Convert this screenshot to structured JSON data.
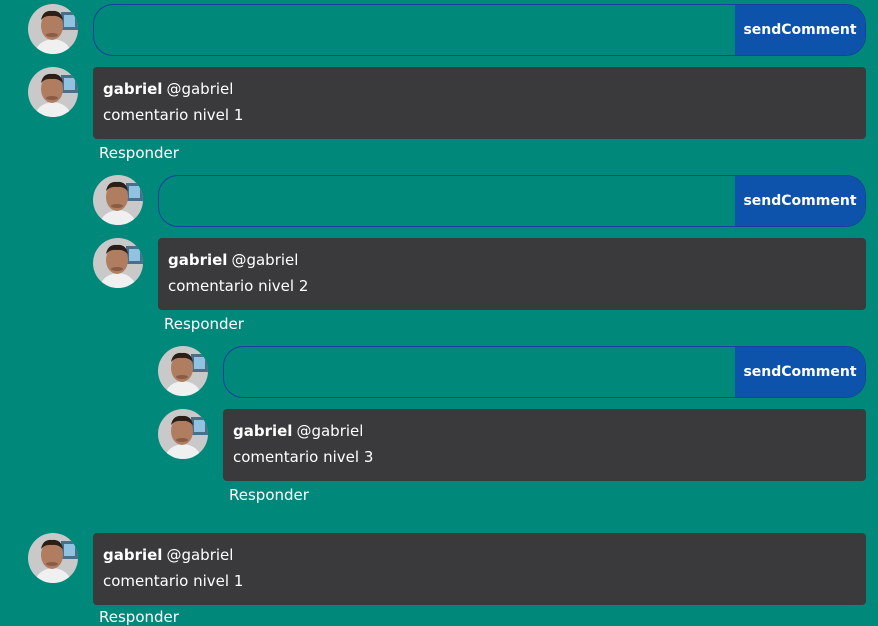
{
  "composer": {
    "input_value": "",
    "send_label": "sendComment"
  },
  "comments": [
    {
      "author": "gabriel",
      "handle": "@gabriel",
      "text": "comentario nivel 1",
      "reply_label": "Responder"
    },
    {
      "author": "gabriel",
      "handle": "@gabriel",
      "text": "comentario nivel 2",
      "reply_label": "Responder"
    },
    {
      "author": "gabriel",
      "handle": "@gabriel",
      "text": "comentario nivel 3",
      "reply_label": "Responder"
    },
    {
      "author": "gabriel",
      "handle": "@gabriel",
      "text": "comentario nivel 1",
      "reply_label": "Responder"
    }
  ],
  "colors": {
    "background": "#00897b",
    "comment_box": "#3a3a3d",
    "send_button": "#0d53ac",
    "form_border": "#1a3fa0"
  },
  "icons": {
    "avatar": "user-avatar-photo"
  }
}
